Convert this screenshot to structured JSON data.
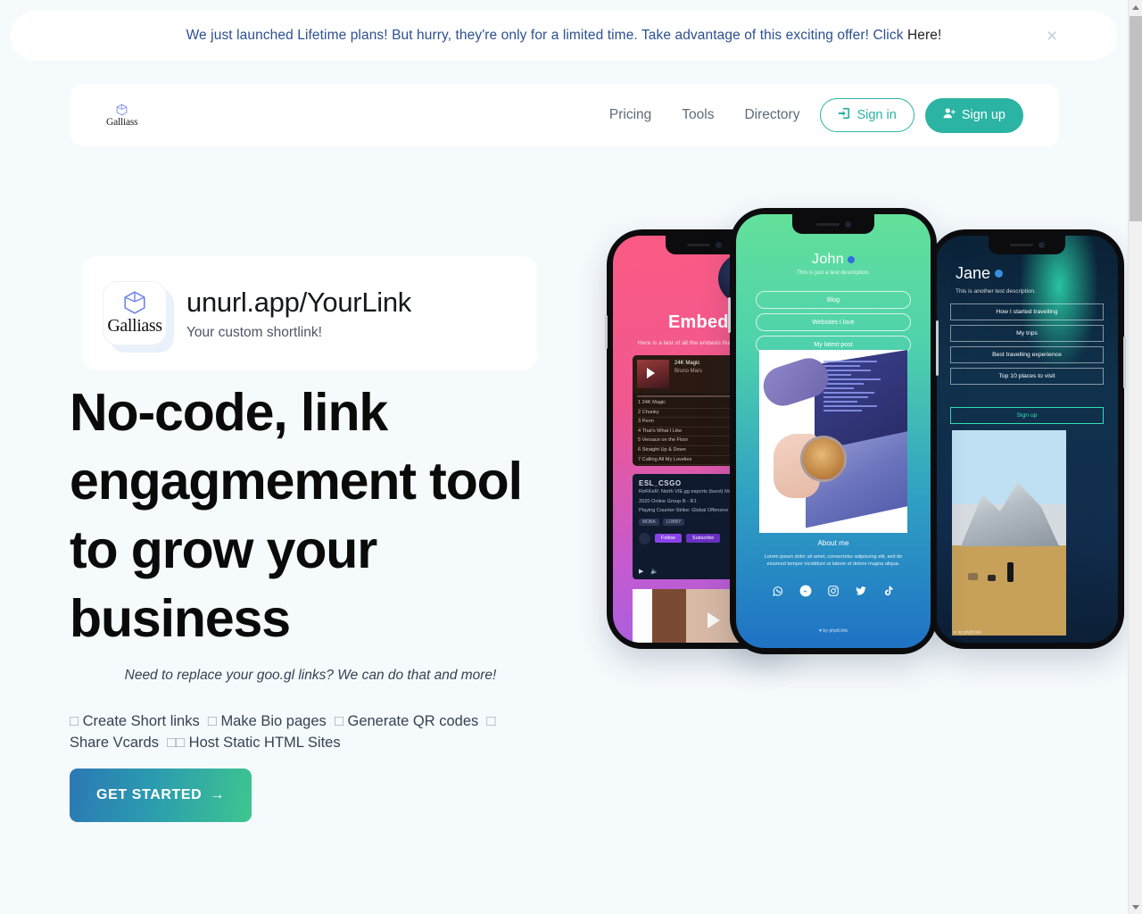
{
  "banner": {
    "message": "We just launched Lifetime plans! But hurry, they're only for a limited time. Take advantage of this exciting offer! Click ",
    "link_text": "Here!",
    "close_label": "×",
    "text_color": "#2c5090"
  },
  "nav": {
    "brand": "Galliass",
    "links": [
      {
        "label": "Pricing"
      },
      {
        "label": "Tools"
      },
      {
        "label": "Directory"
      }
    ],
    "signin_label": "Sign in",
    "signup_label": "Sign up",
    "accent_color": "#2bb3a3"
  },
  "hero": {
    "card": {
      "logo_word": "Galliass",
      "url": "unurl.app/YourLink",
      "subtitle": "Your custom shortlink!"
    },
    "headline": "No-code, link engagmement tool to grow your business",
    "tagline": "Need to replace your goo.gl links? We can do that and more!",
    "features_line1": "Create Short links   Make Bio pages   Generate QR codes   Share",
    "features_line2": "Vcards    Host Static HTML Sites",
    "features": [
      "Create Short links",
      "Make Bio pages",
      "Generate QR codes",
      "Share Vcards",
      "Host Static HTML Sites"
    ],
    "cta_label": "GET STARTED",
    "cta_arrow": "→"
  },
  "phones": {
    "left": {
      "title": "Embeds",
      "description": "Here is a test of all the embeds that can be used",
      "embed_music": {
        "track": "24K Magic",
        "artist": "Bruno Mars",
        "tracklist": [
          "1   24K Magic",
          "2   Chunky",
          "3   Perm",
          "4   That's What I Like",
          "5   Versace on the Floor",
          "6   Straight Up & Down",
          "7   Calling All My Lovelies"
        ]
      },
      "embed_stream": {
        "channel": "ESL_CSGO",
        "line1": "ReKKeR: North VIE.gg esports (burst) Map 2 -",
        "line2": "2020 Online   Group B - R1",
        "line3": "Playing Counter-Strike: Global Offensive for 1:5",
        "tags": [
          "MOBA",
          "LOBBY"
        ],
        "follow_label": "Follow",
        "subscribe_label": "Subscribe"
      }
    },
    "center": {
      "name": "John",
      "description": "This is just a test description.",
      "buttons": [
        "Blog",
        "Websites I love",
        "My latest post"
      ],
      "about_title": "About me",
      "about_text": "Lorem ipsum dolor sit amet, consectetur adipiscing elit, sed do eiusmod tempor incididunt ut labore et dolore magna aliqua.",
      "socials": [
        "whatsapp-icon",
        "messenger-icon",
        "instagram-icon",
        "twitter-icon",
        "tiktok-icon"
      ],
      "credit": "by php8.link"
    },
    "right": {
      "name": "Jane",
      "description": "This is another test description.",
      "buttons": [
        "How I started travelling",
        "My trips",
        "Best travelling experience",
        "Top 10 places to visit"
      ],
      "signup_label": "Sign up",
      "credit": "by php8.link"
    }
  },
  "scrollbar": {
    "up_arrow": "▲",
    "down_arrow": "▼"
  }
}
